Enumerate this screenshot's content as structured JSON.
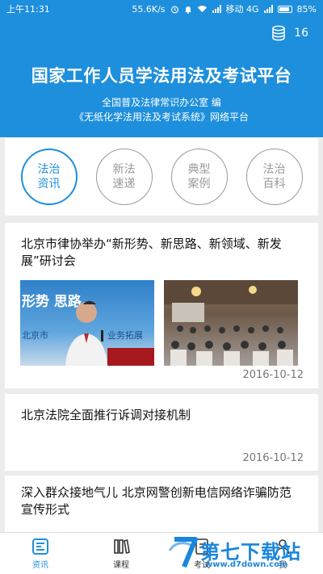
{
  "status_bar": {
    "time": "上午11:31",
    "speed": "55.6K/s",
    "network": "移动 4G",
    "battery": "85%"
  },
  "header": {
    "count": "16",
    "title": "国家工作人员学法用法及考试平台",
    "subtitle1": "全国普及法律常识办公室 编",
    "subtitle2": "《无纸化学法用法及考试系统》网络平台",
    "colors": {
      "primary": "#1e8fdc"
    }
  },
  "categories": [
    {
      "line1": "法治",
      "line2": "资讯",
      "active": true
    },
    {
      "line1": "新法",
      "line2": "速递",
      "active": false
    },
    {
      "line1": "典型",
      "line2": "案例",
      "active": false
    },
    {
      "line1": "法治",
      "line2": "百科",
      "active": false
    }
  ],
  "news": [
    {
      "title": "北京市律协举办“新形势、新思路、新领域、新发展”研讨会",
      "date": "2016-10-12",
      "banner_text": "形势   思路",
      "banner_sub": "北京市",
      "banner_sub2": "业务拓展"
    },
    {
      "title": "北京法院全面推行诉调对接机制",
      "date": "2016-10-12"
    },
    {
      "title": "深入群众接地气儿 北京网警创新电信网络诈骗防范宣传形式"
    }
  ],
  "tabs": [
    {
      "label": "资讯",
      "icon": "news-icon",
      "active": true
    },
    {
      "label": "课程",
      "icon": "books-icon",
      "active": false
    },
    {
      "label": "考试",
      "icon": "exam-icon",
      "active": false
    },
    {
      "label": "我",
      "icon": "profile-icon",
      "active": false
    }
  ],
  "watermark": {
    "text": "第七下载站",
    "url": "www.d7down.com",
    "logo_char": "7"
  }
}
